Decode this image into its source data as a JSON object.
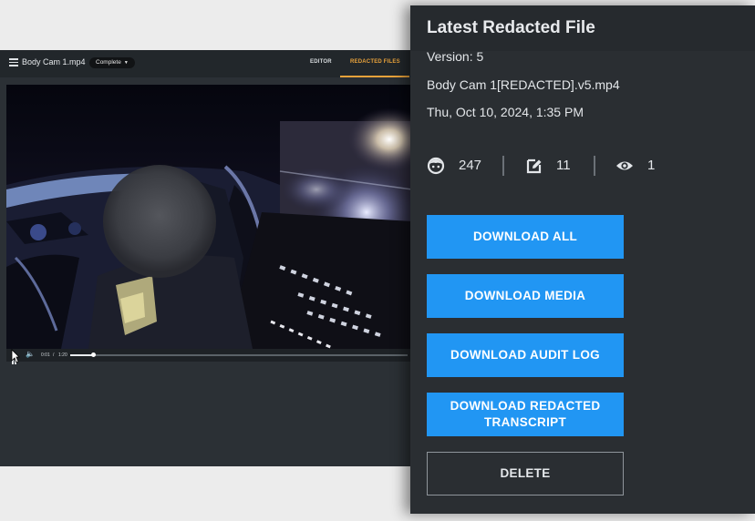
{
  "app": {
    "file_title": "Body Cam 1.mp4",
    "status": "Complete",
    "tabs": [
      {
        "label": "EDITOR",
        "active": false
      },
      {
        "label": "REDACTED FILES",
        "active": true
      }
    ],
    "accent_color": "#e9a23b",
    "player": {
      "current_time": "0:01",
      "separator": "/",
      "total_time": "1:20",
      "progress": 0.07
    }
  },
  "panel": {
    "title": "Latest Redacted File",
    "version": "Version: 5",
    "filename": "Body Cam 1[REDACTED].v5.mp4",
    "timestamp": "Thu, Oct 10, 2024, 1:35 PM",
    "stats": [
      {
        "icon": "face-icon",
        "value": "247"
      },
      {
        "icon": "edit-box-icon",
        "value": "11"
      },
      {
        "icon": "eye-icon",
        "value": "1"
      }
    ],
    "buttons": {
      "download_all": "DOWNLOAD ALL",
      "download_media": "DOWNLOAD MEDIA",
      "download_audit_log": "DOWNLOAD AUDIT LOG",
      "download_transcript_line1": "DOWNLOAD REDACTED",
      "download_transcript_line2": "TRANSCRIPT",
      "delete": "DELETE"
    },
    "button_color": "#2196f3"
  }
}
